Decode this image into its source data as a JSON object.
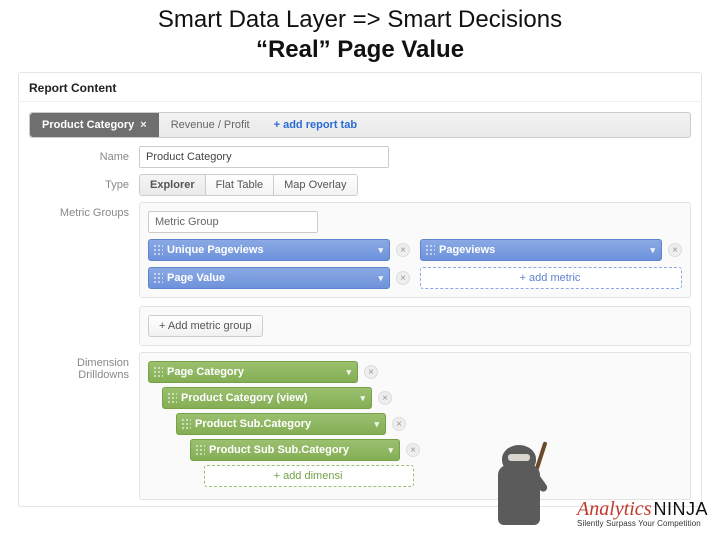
{
  "slide": {
    "title": "Smart Data Layer => Smart Decisions",
    "subtitle": "“Real” Page Value"
  },
  "panel": {
    "header": "Report Content"
  },
  "tabs": {
    "items": [
      {
        "label": "Product Category",
        "active": true
      },
      {
        "label": "Revenue / Profit",
        "active": false
      }
    ],
    "add_label": "+ add report tab"
  },
  "fields": {
    "name_label": "Name",
    "name_value": "Product Category",
    "type_label": "Type",
    "type_options": [
      "Explorer",
      "Flat Table",
      "Map Overlay"
    ],
    "type_selected": "Explorer",
    "metric_groups_label": "Metric Groups",
    "metric_group_name": "Metric Group",
    "metrics": [
      {
        "label": "Unique Pageviews"
      },
      {
        "label": "Pageviews"
      },
      {
        "label": "Page Value"
      }
    ],
    "add_metric_label": "+ add metric",
    "add_metric_group_label": "+ Add metric group",
    "drilldowns_label": "Dimension Drilldowns",
    "drilldowns": [
      {
        "label": "Page Category"
      },
      {
        "label": "Product Category (view)"
      },
      {
        "label": "Product Sub.Category"
      },
      {
        "label": "Product Sub Sub.Category"
      }
    ],
    "add_dimension_label": "+ add dimensi"
  },
  "brand": {
    "word1": "Analytics",
    "word2": "NINJA",
    "tagline": "Silently Surpass Your Competition"
  }
}
